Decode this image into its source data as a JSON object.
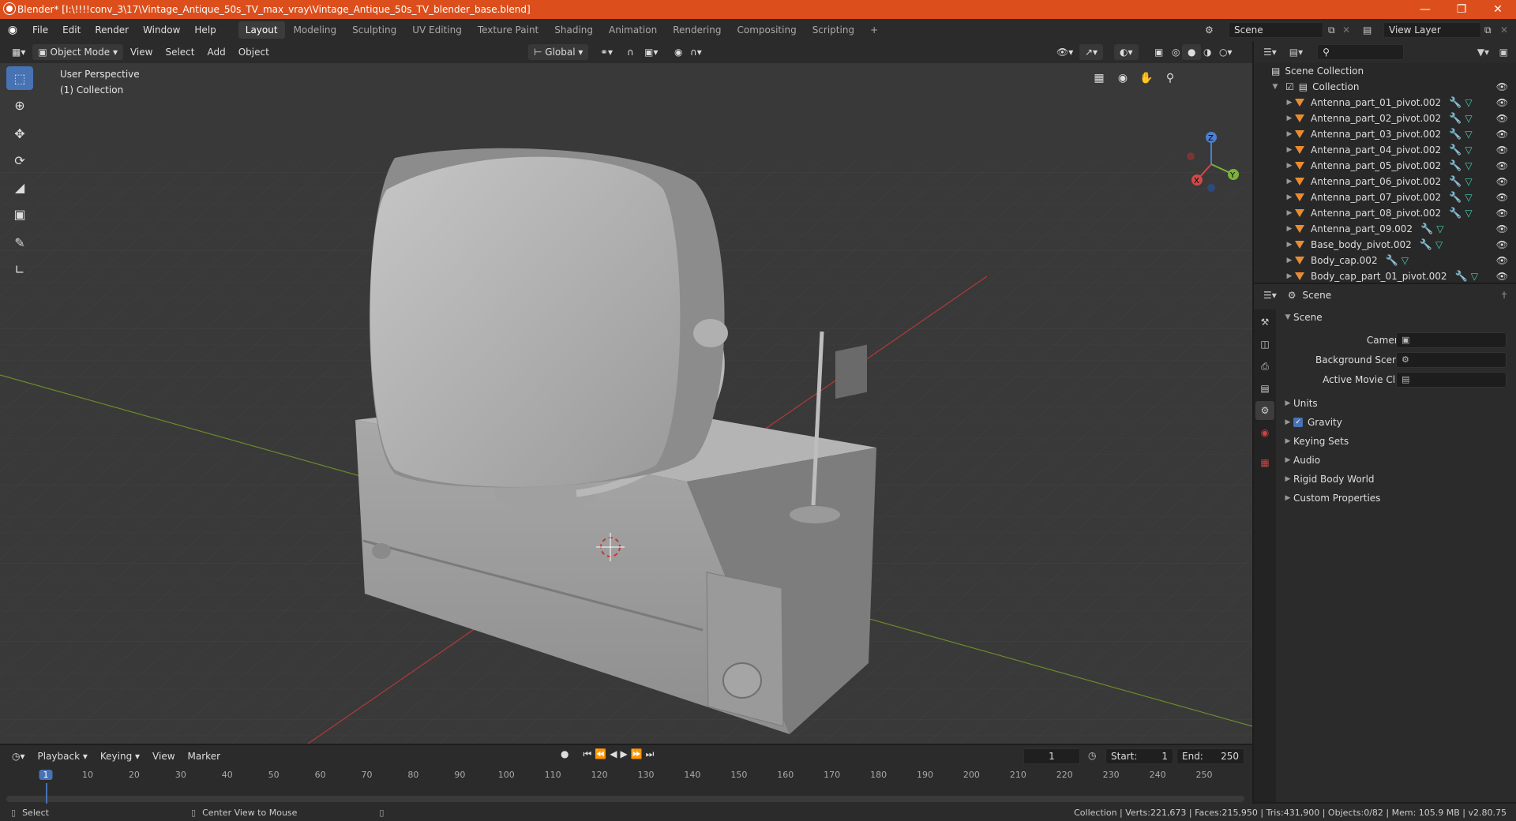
{
  "window": {
    "title": "Blender* [I:\\!!!!conv_3\\17\\Vintage_Antique_50s_TV_max_vray\\Vintage_Antique_50s_TV_blender_base.blend]"
  },
  "menu": [
    "File",
    "Edit",
    "Render",
    "Window",
    "Help"
  ],
  "workspaces": [
    "Layout",
    "Modeling",
    "Sculpting",
    "UV Editing",
    "Texture Paint",
    "Shading",
    "Animation",
    "Rendering",
    "Compositing",
    "Scripting"
  ],
  "scene_field": "Scene",
  "view_layer_field": "View Layer",
  "viewport_header": {
    "mode": "Object Mode",
    "items": [
      "View",
      "Select",
      "Add",
      "Object"
    ],
    "orientation": "Global"
  },
  "viewport": {
    "perspective": "User Perspective",
    "collection": "(1) Collection"
  },
  "gizmo": {
    "z": "Z",
    "y": "Y",
    "x": "X"
  },
  "outliner": {
    "root": "Scene Collection",
    "collection": "Collection",
    "items": [
      "Antenna_part_01_pivot.002",
      "Antenna_part_02_pivot.002",
      "Antenna_part_03_pivot.002",
      "Antenna_part_04_pivot.002",
      "Antenna_part_05_pivot.002",
      "Antenna_part_06_pivot.002",
      "Antenna_part_07_pivot.002",
      "Antenna_part_08_pivot.002",
      "Antenna_part_09.002",
      "Base_body_pivot.002",
      "Body_cap.002",
      "Body_cap_part_01_pivot.002"
    ]
  },
  "properties": {
    "header": "Scene",
    "panel": "Scene",
    "rows": [
      {
        "label": "Camera"
      },
      {
        "label": "Background Scene"
      },
      {
        "label": "Active Movie Clip"
      }
    ],
    "subpanels": [
      "Units",
      "Gravity",
      "Keying Sets",
      "Audio",
      "Rigid Body World",
      "Custom Properties"
    ]
  },
  "timeline": {
    "menus": [
      "Playback",
      "Keying",
      "View",
      "Marker"
    ],
    "current_frame": "1",
    "start_label": "Start:",
    "start": "1",
    "end_label": "End:",
    "end": "250",
    "ticks": [
      "1",
      "10",
      "20",
      "30",
      "40",
      "50",
      "60",
      "70",
      "80",
      "90",
      "100",
      "110",
      "120",
      "130",
      "140",
      "150",
      "160",
      "170",
      "180",
      "190",
      "200",
      "210",
      "220",
      "230",
      "240",
      "250"
    ]
  },
  "statusbar": {
    "left": "Select",
    "middle": "Center View to Mouse",
    "stats": "Collection | Verts:221,673 | Faces:215,950 | Tris:431,900 | Objects:0/82 | Mem: 105.9 MB | v2.80.75"
  },
  "colors": {
    "accent": "#4772b3",
    "titlebar": "#dc4f1c",
    "object_icon": "#e88c34",
    "mesh_icon": "#40d4b5"
  }
}
